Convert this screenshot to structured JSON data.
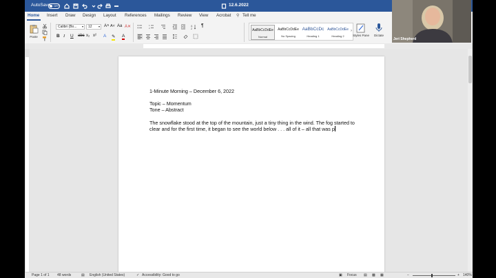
{
  "titlebar": {
    "autosave_label": "AutoSave",
    "autosave_state": "OFF",
    "doc_title": "12.6.2022",
    "accent": "#2b579a"
  },
  "tabs": [
    "Home",
    "Insert",
    "Draw",
    "Design",
    "Layout",
    "References",
    "Mailings",
    "Review",
    "View",
    "Acrobat",
    "Tell me"
  ],
  "ribbon": {
    "paste_label": "Paste",
    "font_name": "Calibri (Bo...",
    "font_size": "12",
    "styles": [
      {
        "sample": "AaBbCcDdEe",
        "name": "Normal"
      },
      {
        "sample": "AaBbCcDdEe",
        "name": "No Spacing"
      },
      {
        "sample": "AaBbCcDc",
        "name": "Heading 1"
      },
      {
        "sample": "AaBbCcDdEe",
        "name": "Heading 2"
      }
    ],
    "styles_pane_label": "Styles Pane",
    "dictate_label": "Dictate",
    "icons": [
      "paste-icon",
      "cut-icon",
      "copy-icon",
      "format-painter-icon",
      "bullets-icon",
      "numbering-icon",
      "multilevel-list-icon",
      "indent-icon",
      "sort-icon",
      "pilcrow-icon",
      "bold-icon",
      "italic-icon",
      "underline-icon",
      "strikethrough-icon",
      "font-color-icon",
      "highlight-icon",
      "microphone-icon"
    ]
  },
  "document": {
    "lines": [
      "1-Minute Morning – December 6, 2022",
      "Topic – Momentum",
      "Tone – Abstract",
      "The snowflake stood at the top of the mountain, just a tiny thing in the wind. The fog started to",
      "clear and for the first time, it began to see the world below . . . all of it – all that was p"
    ]
  },
  "status": {
    "page": "Page 1 of 1",
    "words": "48 words",
    "language": "English (United States)",
    "accessibility": "Accessibility: Good to go",
    "focus": "Focus",
    "zoom": "140%"
  },
  "video": {
    "name": "Jeri Shepherd"
  }
}
